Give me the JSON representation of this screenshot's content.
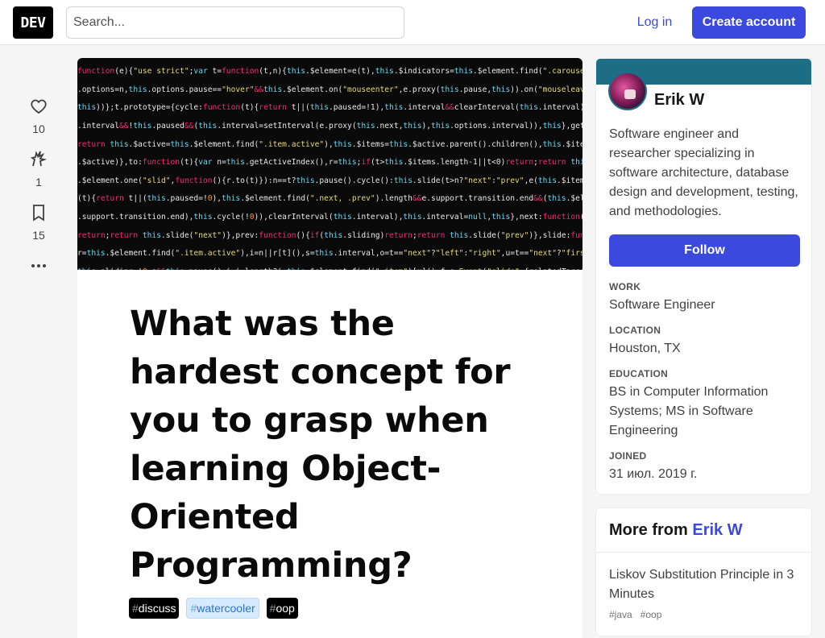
{
  "header": {
    "logo_text": "DEV",
    "search_placeholder": "Search...",
    "login_label": "Log in",
    "create_account_label": "Create account"
  },
  "reactions": [
    {
      "icon": "heart-icon",
      "count": "10"
    },
    {
      "icon": "unicorn-icon",
      "count": "1"
    },
    {
      "icon": "bookmark-icon",
      "count": "15"
    }
  ],
  "article": {
    "title": "What was the hardest concept for you to grasp when learning Object-Oriented Programming?",
    "tags": [
      {
        "hash": "#",
        "name": "discuss"
      },
      {
        "hash": "#",
        "name": "watercooler"
      },
      {
        "hash": "#",
        "name": "oop"
      }
    ]
  },
  "profile": {
    "name": "Erik W",
    "bio": "Software engineer and researcher specializing in software architecture, database design and development, testing, and methodologies.",
    "follow_label": "Follow",
    "work_label": "Work",
    "work_value": "Software Engineer",
    "location_label": "Location",
    "location_value": "Houston, TX",
    "education_label": "Education",
    "education_value": "BS in Computer Information Systems; MS in Software Engineering",
    "joined_label": "Joined",
    "joined_value": "31 июл. 2019 г.",
    "accent_color": "#1d6e84"
  },
  "more_from": {
    "prefix": "More from",
    "author": "Erik W",
    "items": [
      {
        "title": "Liskov Substitution Principle in 3 Minutes",
        "tags": [
          "#java",
          "#oop"
        ]
      }
    ]
  },
  "colors": {
    "primary": "#3b49df",
    "background": "#f5f5f5"
  }
}
